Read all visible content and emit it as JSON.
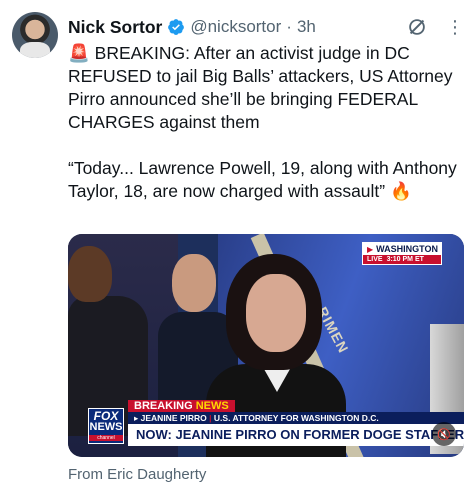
{
  "tweet": {
    "display_name": "Nick Sortor",
    "handle": "@nicksortor",
    "separator": "·",
    "time": "3h",
    "text_lines": [
      "🚨 BREAKING: After an activist judge in DC REFUSED to jail Big Balls’ attackers, US Attorney Pirro announced she’ll be bringing FEDERAL CHARGES against them",
      "“Today... Lawrence Powell, 19, along with Anthony Taylor, 18, are now charged with assault” 🔥"
    ],
    "source_label": "From Eric Daugherty"
  },
  "icons": {
    "verified": "verified-badge-icon",
    "grok": "grok-icon",
    "more": "more-icon",
    "mute": "mute-icon"
  },
  "colors": {
    "verified_blue": "#1d9bf0",
    "secondary_text": "#536471",
    "fox_red": "#c8102e",
    "fox_blue": "#0b1e5c"
  },
  "video": {
    "live_location": "WASHINGTON",
    "live_label": "LIVE",
    "live_time": "3:10 PM ET",
    "fox_logo": [
      "FOX",
      "NEWS",
      "channel"
    ],
    "breaking": "BREAKING",
    "breaking_news": "NEWS",
    "subject_name": "JEANINE PIRRO",
    "subject_title": "U.S. ATTORNEY FOR WASHINGTON D.C.",
    "headline": "NOW: JEANINE PIRRO ON FORMER DOGE STAFFER ATTACK",
    "flag_text": "RIMEN"
  }
}
